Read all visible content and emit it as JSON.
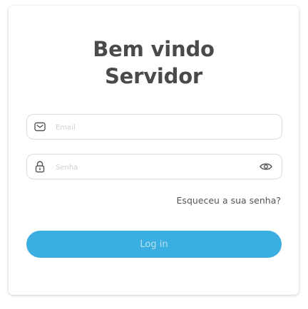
{
  "header": {
    "title_line1": "Bem vindo",
    "title_line2": "Servidor"
  },
  "form": {
    "email": {
      "placeholder": "Email",
      "value": "",
      "icon": "mail-icon"
    },
    "password": {
      "placeholder": "Senha",
      "value": "",
      "icon": "lock-icon",
      "toggle_icon": "eye-icon"
    },
    "forgot_label": "Esqueceu a sua senha?",
    "login_label": "Log in"
  },
  "colors": {
    "accent": "#3aaee0",
    "text": "#4a4a4a"
  }
}
